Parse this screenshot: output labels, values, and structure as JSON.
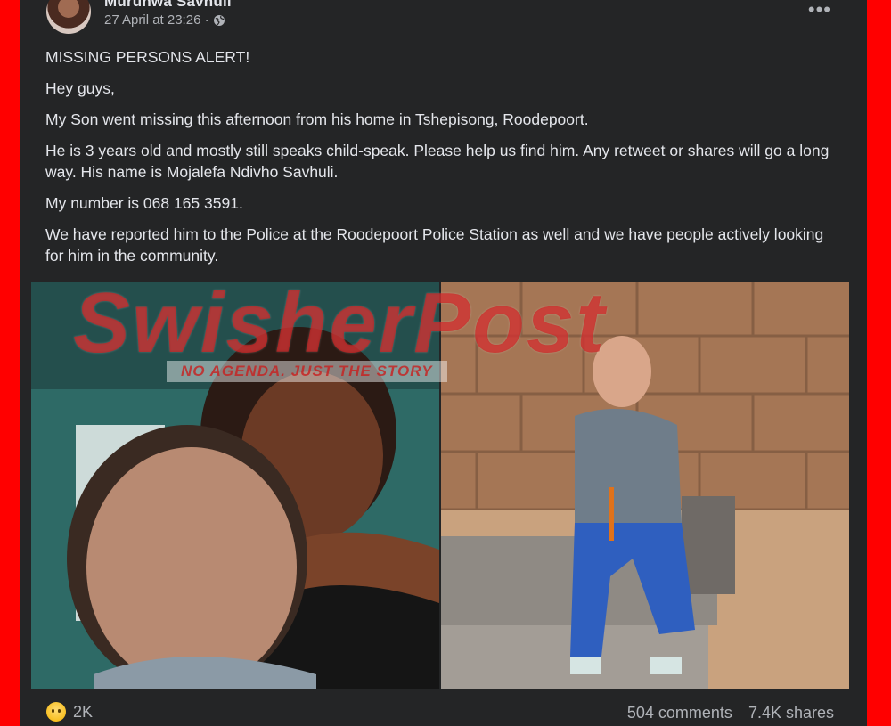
{
  "post": {
    "author": "Murunwa Savhuli",
    "timestamp": "27 April at 23:26 ·",
    "privacy_icon": "globe-icon",
    "more_label": "•••",
    "paragraphs": [
      "MISSING PERSONS ALERT!",
      "Hey guys,",
      "My Son went missing this afternoon from his home in Tshepisong, Roodepoort.",
      "He is 3 years old and mostly still speaks child-speak. Please help us find him. Any retweet or shares will go a long way. His name is Mojalefa Ndivho Savhuli.",
      "My number is 068 165 3591.",
      "We have reported him to the Police at the Roodepoort Police Station as well and we have people actively looking for him in the community."
    ]
  },
  "watermark": {
    "brand": "SwisherPost",
    "tagline": "NO AGENDA. JUST THE STORY"
  },
  "footer": {
    "reaction_icon": "sad-reaction-icon",
    "reaction_count": "2K",
    "comments": "504 comments",
    "shares": "7.4K shares"
  },
  "colors": {
    "frame": "#ff0000",
    "card": "#242526",
    "text": "#e4e6eb",
    "secondary": "#b0b3b8"
  }
}
